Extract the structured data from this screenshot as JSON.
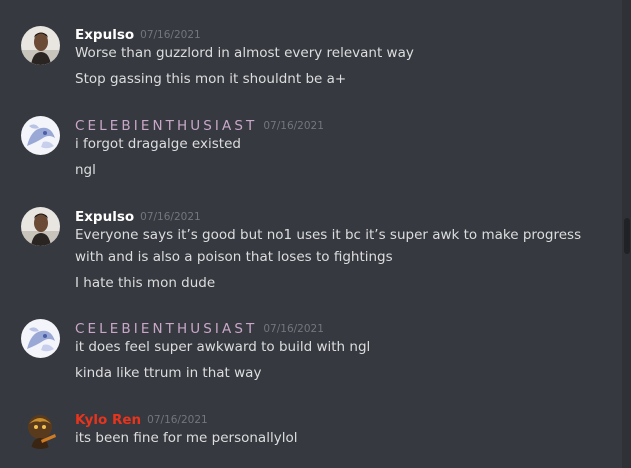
{
  "colors": {
    "background": "#36393f",
    "text": "#dcddde",
    "timestamp": "#72767d",
    "user_expulso": "#ffffff",
    "user_celebi": "#c9a7c8",
    "user_kylo": "#e8341c"
  },
  "messages": [
    {
      "username": "Expulso",
      "timestamp": "07/16/2021",
      "avatar_icon": "portrait-avatar-icon",
      "lines": [
        "Worse than guzzlord in almost every relevant way",
        "Stop gassing this mon it shouldnt be a+"
      ]
    },
    {
      "username": "CELEBIENTHUSIAST",
      "timestamp": "07/16/2021",
      "avatar_icon": "pokemon-avatar-icon",
      "lines": [
        "i forgot dragalge existed",
        "ngl"
      ]
    },
    {
      "username": "Expulso",
      "timestamp": "07/16/2021",
      "avatar_icon": "portrait-avatar-icon",
      "lines": [
        "Everyone says it’s good but no1 uses it bc it’s super awk to make progress",
        "with and is also a poison that loses to fightings",
        "I hate this mon dude"
      ]
    },
    {
      "username": "CELEBIENTHUSIAST",
      "timestamp": "07/16/2021",
      "avatar_icon": "pokemon-avatar-icon",
      "lines": [
        "it does feel super awkward to build with ngl",
        "kinda like ttrum in that way"
      ]
    },
    {
      "username": "Kylo Ren",
      "timestamp": "07/16/2021",
      "avatar_icon": "character-avatar-icon",
      "lines": [
        "its been fine for me personallylol"
      ]
    }
  ]
}
